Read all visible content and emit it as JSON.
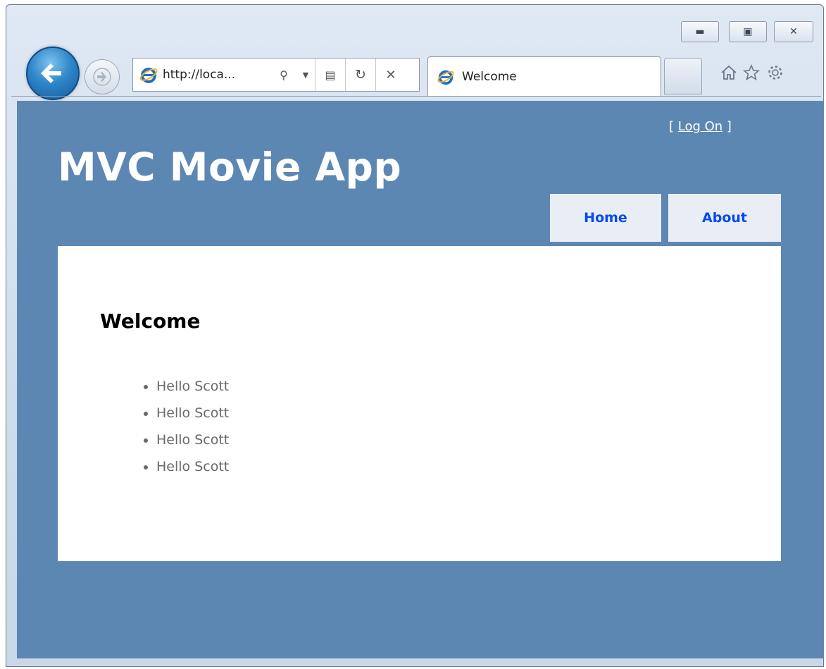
{
  "browser": {
    "url": "http://loca...",
    "tab_title": "Welcome",
    "icons": {
      "back": "back-arrow-icon",
      "forward": "forward-arrow-icon",
      "ie": "ie-logo-icon",
      "search": "search-icon",
      "dropdown": "dropdown-arrow-icon",
      "compat": "compatibility-view-icon",
      "refresh": "refresh-icon",
      "stop": "close-icon",
      "home": "home-icon",
      "favorites": "star-icon",
      "tools": "gear-icon"
    }
  },
  "header": {
    "logon_open": "[ ",
    "logon_link": "Log On",
    "logon_close": " ]",
    "title": "MVC Movie App"
  },
  "menu": {
    "items": [
      {
        "label": "Home"
      },
      {
        "label": "About"
      }
    ]
  },
  "main": {
    "heading": "Welcome",
    "messages": [
      "Hello Scott",
      "Hello Scott",
      "Hello Scott",
      "Hello Scott"
    ]
  },
  "colors": {
    "page_background": "#5c87b2",
    "menu_background": "#e8eef4",
    "menu_link": "#034af3",
    "list_text": "#696969"
  }
}
